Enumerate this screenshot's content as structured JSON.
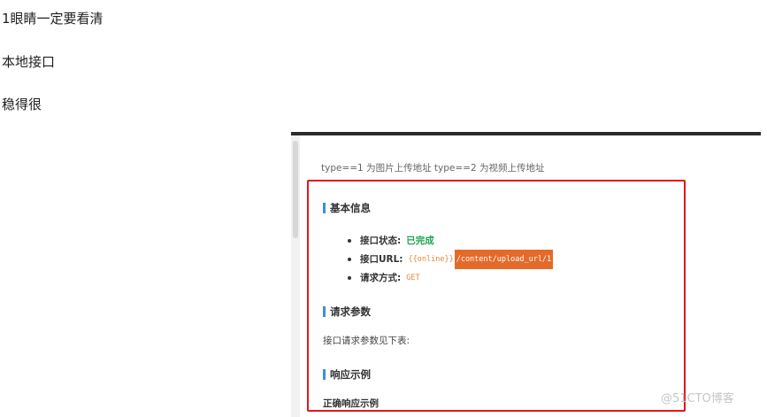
{
  "paragraphs": {
    "p1": "1眼睛一定要看清",
    "p2": "本地接口",
    "p3": "稳得很"
  },
  "screenshot": {
    "note": "type==1 为图片上传地址 type==2 为视频上传地址",
    "section_basic": {
      "title": "基本信息",
      "items": [
        {
          "key": "接口状态:",
          "value": "已完成"
        },
        {
          "key": "接口URL:",
          "value_var": "{{online}}",
          "value_path": "/content/upload_url/1"
        },
        {
          "key": "请求方式:",
          "value": "GET"
        }
      ]
    },
    "section_params": {
      "title": "请求参数",
      "text": "接口请求参数见下表:"
    },
    "section_response": {
      "title": "响应示例",
      "subtitle": "正确响应示例"
    },
    "watermark": "@51CTO博客"
  },
  "colors": {
    "highlight_border": "#e0171b",
    "status_ok": "#1ea553",
    "url_highlight": "#e46a2a",
    "section_bar": "#3a8ee6"
  },
  "icons": {
    "bullet": "bullet-dot-icon",
    "section_marker": "section-bar-icon"
  }
}
